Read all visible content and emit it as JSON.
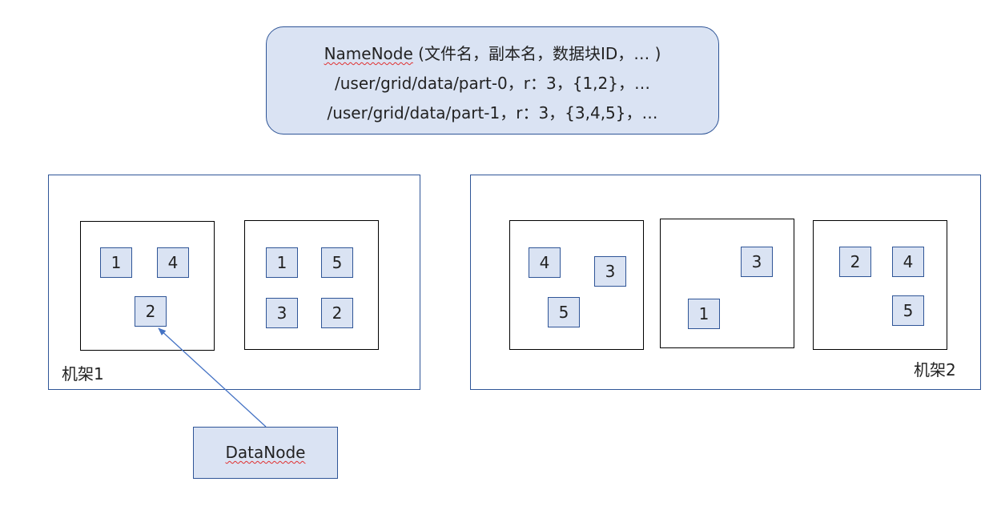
{
  "namenode": {
    "title": "NameNode",
    "title_rest": " (文件名，副本名，数据块ID，… )",
    "rows": [
      "/user/grid/data/part-0，r：3，{1,2}，…",
      "/user/grid/data/part-1，r：3，{3,4,5}，…"
    ]
  },
  "racks": [
    {
      "label": "机架1",
      "nodes": [
        {
          "blocks": [
            "1",
            "4",
            "2"
          ]
        },
        {
          "blocks": [
            "1",
            "5",
            "3",
            "2"
          ]
        }
      ]
    },
    {
      "label": "机架2",
      "nodes": [
        {
          "blocks": [
            "4",
            "3",
            "5"
          ]
        },
        {
          "blocks": [
            "3",
            "1"
          ]
        },
        {
          "blocks": [
            "2",
            "4",
            "5"
          ]
        }
      ]
    }
  ],
  "datanode": {
    "label": "DataNode"
  },
  "colors": {
    "fill": "#dae3f3",
    "border": "#2f5597",
    "node_border": "#000000"
  }
}
